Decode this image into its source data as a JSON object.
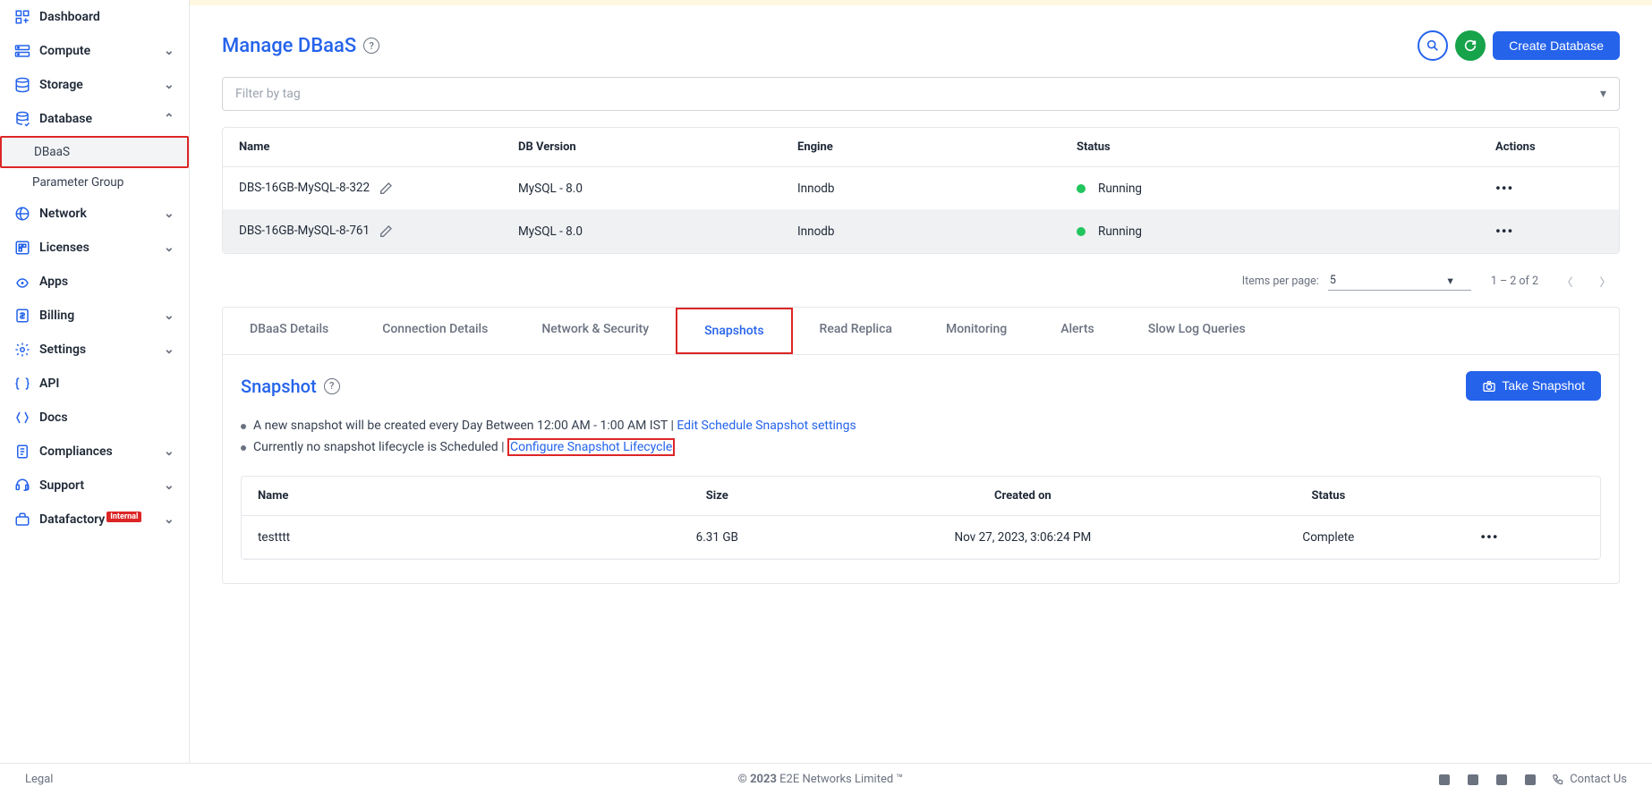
{
  "sidebar": {
    "items": [
      {
        "label": "Dashboard",
        "expandable": false
      },
      {
        "label": "Compute",
        "expandable": true
      },
      {
        "label": "Storage",
        "expandable": true
      },
      {
        "label": "Database",
        "expandable": true,
        "expanded": true,
        "subs": [
          "DBaaS",
          "Parameter Group"
        ]
      },
      {
        "label": "Network",
        "expandable": true
      },
      {
        "label": "Licenses",
        "expandable": true
      },
      {
        "label": "Apps",
        "expandable": false
      },
      {
        "label": "Billing",
        "expandable": true
      },
      {
        "label": "Settings",
        "expandable": true
      },
      {
        "label": "API",
        "expandable": false
      },
      {
        "label": "Docs",
        "expandable": false
      },
      {
        "label": "Compliances",
        "expandable": true
      },
      {
        "label": "Support",
        "expandable": true
      },
      {
        "label": "Datafactory",
        "expandable": true,
        "badge": "Internal"
      }
    ]
  },
  "page": {
    "title": "Manage DBaaS",
    "create_btn": "Create Database",
    "filter_placeholder": "Filter by tag"
  },
  "db_table": {
    "headers": {
      "name": "Name",
      "dbv": "DB Version",
      "engine": "Engine",
      "status": "Status",
      "actions": "Actions"
    },
    "rows": [
      {
        "name": "DBS-16GB-MySQL-8-322",
        "dbv": "MySQL - 8.0",
        "engine": "Innodb",
        "status": "Running"
      },
      {
        "name": "DBS-16GB-MySQL-8-761",
        "dbv": "MySQL - 8.0",
        "engine": "Innodb",
        "status": "Running"
      }
    ]
  },
  "pagination": {
    "label": "Items per page:",
    "value": "5",
    "range": "1 – 2 of 2"
  },
  "tabs": [
    "DBaaS Details",
    "Connection Details",
    "Network & Security",
    "Snapshots",
    "Read Replica",
    "Monitoring",
    "Alerts",
    "Slow Log Queries"
  ],
  "snapshot": {
    "title": "Snapshot",
    "take_btn": "Take Snapshot",
    "line1_pre": "A new snapshot will be created every Day Between 12:00 AM - 1:00 AM IST | ",
    "line1_link": "Edit Schedule Snapshot settings",
    "line2_pre": "Currently no snapshot lifecycle is Scheduled | ",
    "line2_link": "Configure Snapshot Lifecycle",
    "headers": {
      "name": "Name",
      "size": "Size",
      "created": "Created on",
      "status": "Status"
    },
    "rows": [
      {
        "name": "testttt",
        "size": "6.31 GB",
        "created": "Nov 27, 2023, 3:06:24 PM",
        "status": "Complete"
      }
    ]
  },
  "footer": {
    "legal": "Legal",
    "copyright_b": "© 2023 ",
    "copyright_r": "E2E Networks Limited ™",
    "contact": "Contact Us"
  }
}
